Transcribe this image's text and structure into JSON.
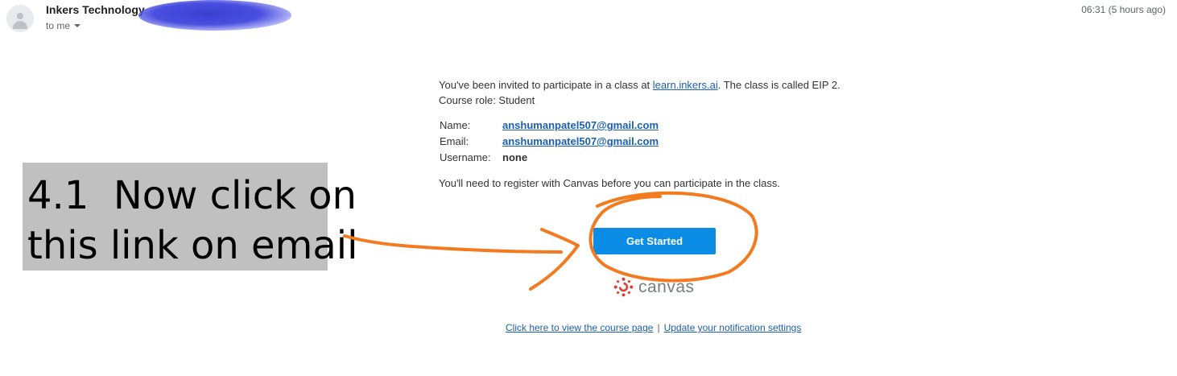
{
  "header": {
    "sender_name": "Inkers Technology",
    "recipient": "to me",
    "timestamp": "06:31 (5 hours ago)"
  },
  "email": {
    "invite_before": "You've been invited to participate in a class at ",
    "invite_link": "learn.inkers.ai",
    "invite_after": ". The class is called EIP 2. Course role: Student",
    "fields": {
      "name_label": "Name:",
      "name_value": "anshumanpatel507@gmail.com",
      "email_label": "Email:",
      "email_value": "anshumanpatel507@gmail.com",
      "username_label": "Username:",
      "username_value": "none"
    },
    "register_text": "You'll need to register with Canvas before you can participate in the class.",
    "button_label": "Get Started",
    "brand_name": "canvas",
    "footer_link_course": "Click here to view the course page",
    "footer_separator": "|",
    "footer_link_notifications": "Update your notification settings"
  },
  "annotation": {
    "line1": "4.1  Now click on",
    "line2": "this link on email",
    "ink_color": "#f47a20"
  },
  "colors": {
    "button": "#0b8de6",
    "link": "#1a5fb4",
    "canvas_red": "#e03c31",
    "note_background": "#c0c0c0"
  }
}
